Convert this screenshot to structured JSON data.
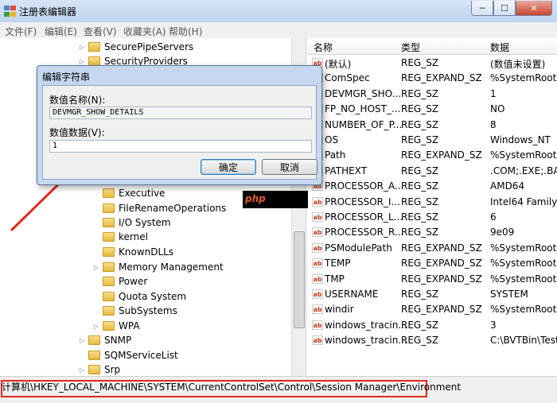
{
  "window": {
    "title": "注册表编辑器",
    "min": "─",
    "max": "☐",
    "close": "✕"
  },
  "menu": [
    {
      "label": "文件(F)"
    },
    {
      "label": "编辑(E)"
    },
    {
      "label": "查看(V)"
    },
    {
      "label": "收藏夹(A)"
    },
    {
      "label": "帮助(H)"
    }
  ],
  "tree": {
    "items": [
      {
        "label": "SecurePipeServers",
        "expander": "▷"
      },
      {
        "label": "SecurityProviders",
        "expander": "▷"
      },
      {
        "label": "Executive",
        "expander": ""
      },
      {
        "label": "FileRenameOperations",
        "expander": ""
      },
      {
        "label": "I/O System",
        "expander": ""
      },
      {
        "label": "kernel",
        "expander": ""
      },
      {
        "label": "KnownDLLs",
        "expander": ""
      },
      {
        "label": "Memory Management",
        "expander": "▷"
      },
      {
        "label": "Power",
        "expander": ""
      },
      {
        "label": "Quota System",
        "expander": ""
      },
      {
        "label": "SubSystems",
        "expander": ""
      },
      {
        "label": "WPA",
        "expander": "▷"
      },
      {
        "label": "SNMP",
        "expander": "▷"
      },
      {
        "label": "SQMServiceList",
        "expander": ""
      },
      {
        "label": "Srp",
        "expander": "▷"
      }
    ]
  },
  "values_table": {
    "columns": [
      "名称",
      "类型",
      "数据"
    ],
    "rows": [
      {
        "name": "(默认)",
        "type": "REG_SZ",
        "data": "(数值未设置)"
      },
      {
        "name": "ComSpec",
        "type": "REG_EXPAND_SZ",
        "data": "%SystemRoot%"
      },
      {
        "name": "DEVMGR_SHO...",
        "type": "REG_SZ",
        "data": "1"
      },
      {
        "name": "FP_NO_HOST_...",
        "type": "REG_SZ",
        "data": "NO"
      },
      {
        "name": "NUMBER_OF_P...",
        "type": "REG_SZ",
        "data": "8"
      },
      {
        "name": "OS",
        "type": "REG_SZ",
        "data": "Windows_NT"
      },
      {
        "name": "Path",
        "type": "REG_EXPAND_SZ",
        "data": "%SystemRoot%"
      },
      {
        "name": "PATHEXT",
        "type": "REG_SZ",
        "data": ".COM;.EXE;.BAT"
      },
      {
        "name": "PROCESSOR_A...",
        "type": "REG_SZ",
        "data": "AMD64"
      },
      {
        "name": "PROCESSOR_I...",
        "type": "REG_SZ",
        "data": "Intel64 Family"
      },
      {
        "name": "PROCESSOR_L...",
        "type": "REG_SZ",
        "data": "6"
      },
      {
        "name": "PROCESSOR_R...",
        "type": "REG_SZ",
        "data": "9e09"
      },
      {
        "name": "PSModulePath",
        "type": "REG_EXPAND_SZ",
        "data": "%SystemRoot%"
      },
      {
        "name": "TEMP",
        "type": "REG_EXPAND_SZ",
        "data": "%SystemRoot%"
      },
      {
        "name": "TMP",
        "type": "REG_EXPAND_SZ",
        "data": "%SystemRoot%"
      },
      {
        "name": "USERNAME",
        "type": "REG_SZ",
        "data": "SYSTEM"
      },
      {
        "name": "windir",
        "type": "REG_EXPAND_SZ",
        "data": "%SystemRoot%"
      },
      {
        "name": "windows_tracin...",
        "type": "REG_SZ",
        "data": "3"
      },
      {
        "name": "windows_tracin...",
        "type": "REG_SZ",
        "data": "C:\\BVTBin\\Test"
      }
    ],
    "value_icon_text": "ab"
  },
  "statusbar": {
    "path": "计算机\\HKEY_LOCAL_MACHINE\\SYSTEM\\CurrentControlSet\\Control\\Session Manager\\Environment"
  },
  "dialog": {
    "title": "编辑字符串",
    "name_label": "数值名称(N):",
    "name_value": "DEVMGR_SHOW_DETAILS",
    "data_label": "数值数据(V):",
    "data_value": "1",
    "ok_label": "确定",
    "cancel_label": "取消"
  },
  "watermark": {
    "text": "php"
  },
  "colors": {
    "annotation_red": "#e0281f",
    "title_bar": "#c8daf0"
  }
}
